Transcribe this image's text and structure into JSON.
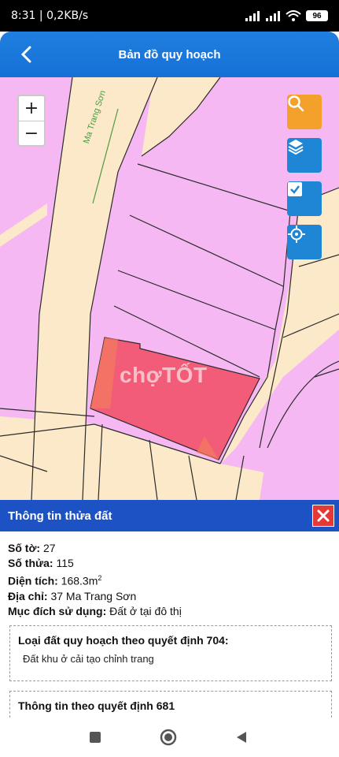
{
  "status_bar": {
    "time": "8:31",
    "network_speed": "0,2KB/s",
    "battery": "96"
  },
  "header": {
    "title": "Bản đồ quy hoạch"
  },
  "map": {
    "street_label": "Ma Trang Sơn",
    "watermark": "chợTỐT",
    "zoom_in": "+",
    "zoom_out": "−",
    "colors": {
      "residential": "#f5b8f2",
      "road": "#fbe9c9",
      "selected": "#f25c78"
    }
  },
  "panel": {
    "title": "Thông tin thửa đất",
    "close_icon": "close-icon",
    "rows": [
      {
        "label": "Số tờ:",
        "value": " 27"
      },
      {
        "label": "Số thửa:",
        "value": " 115"
      },
      {
        "label": "Diện tích:",
        "value": " 168.3m",
        "sup": "2"
      },
      {
        "label": "Địa chỉ:",
        "value": " 37 Ma Trang Sơn"
      },
      {
        "label": "Mục đích sử dụng:",
        "value": " Đất ở tại đô thị"
      }
    ],
    "card1": {
      "title": "Loại đất quy hoạch theo quyết định 704:",
      "text": "Đất khu ở cải tạo chỉnh trang"
    },
    "card2": {
      "title": "Thông tin theo quyết định 681"
    }
  }
}
